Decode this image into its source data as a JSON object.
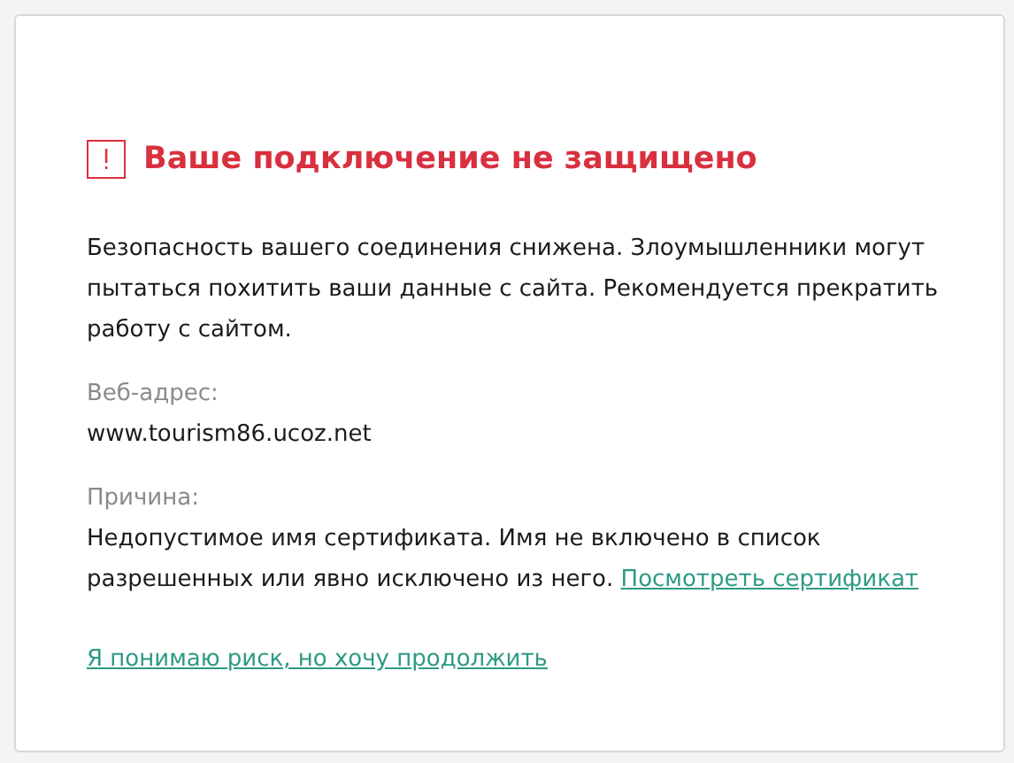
{
  "title": "Ваше подключение не защищено",
  "description": "Безопасность вашего соединения снижена. Злоумышленники могут пытаться похитить ваши данные с сайта. Рекомендуется прекратить работу с сайтом.",
  "fields": [
    {
      "label": "Веб-адрес:",
      "value": "www.tourism86.ucoz.net"
    },
    {
      "label": "Причина:",
      "value": "Недопустимое имя сертификата. Имя не включено в список разрешенных или явно исключено из него.",
      "link": "Посмотреть сертификат"
    }
  ],
  "continue_link": "Я понимаю риск, но хочу продолжить"
}
